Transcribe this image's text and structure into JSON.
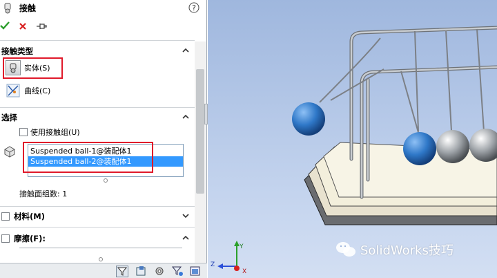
{
  "panel": {
    "title": "接触",
    "help_icon": "question-circle-icon",
    "actions": {
      "ok_icon": "checkmark-icon",
      "cancel_icon": "close-icon",
      "pin_icon": "pushpin-icon"
    },
    "contact_type": {
      "title": "接触类型",
      "options": [
        {
          "label": "实体(S)",
          "icon": "solid-body-icon",
          "selected": true
        },
        {
          "label": "曲线(C)",
          "icon": "curve-icon",
          "selected": false
        }
      ]
    },
    "selection": {
      "title": "选择",
      "use_group_label": "使用接触组(U)",
      "items": [
        "Suspended ball-1@装配体1",
        "Suspended ball-2@装配体1"
      ],
      "face_count_label": "接触面组数: 1"
    },
    "material": {
      "title": "材料(M)"
    },
    "friction": {
      "title": "摩擦(F):"
    }
  },
  "viewport": {
    "watermark": "SolidWorks技巧",
    "triad": {
      "x": "X",
      "y": "Y",
      "z": "Z"
    },
    "colors": {
      "ball_blue": "#2f78c8",
      "ball_gray": "#9ea3a8",
      "frame": "#c8ccd0"
    }
  }
}
